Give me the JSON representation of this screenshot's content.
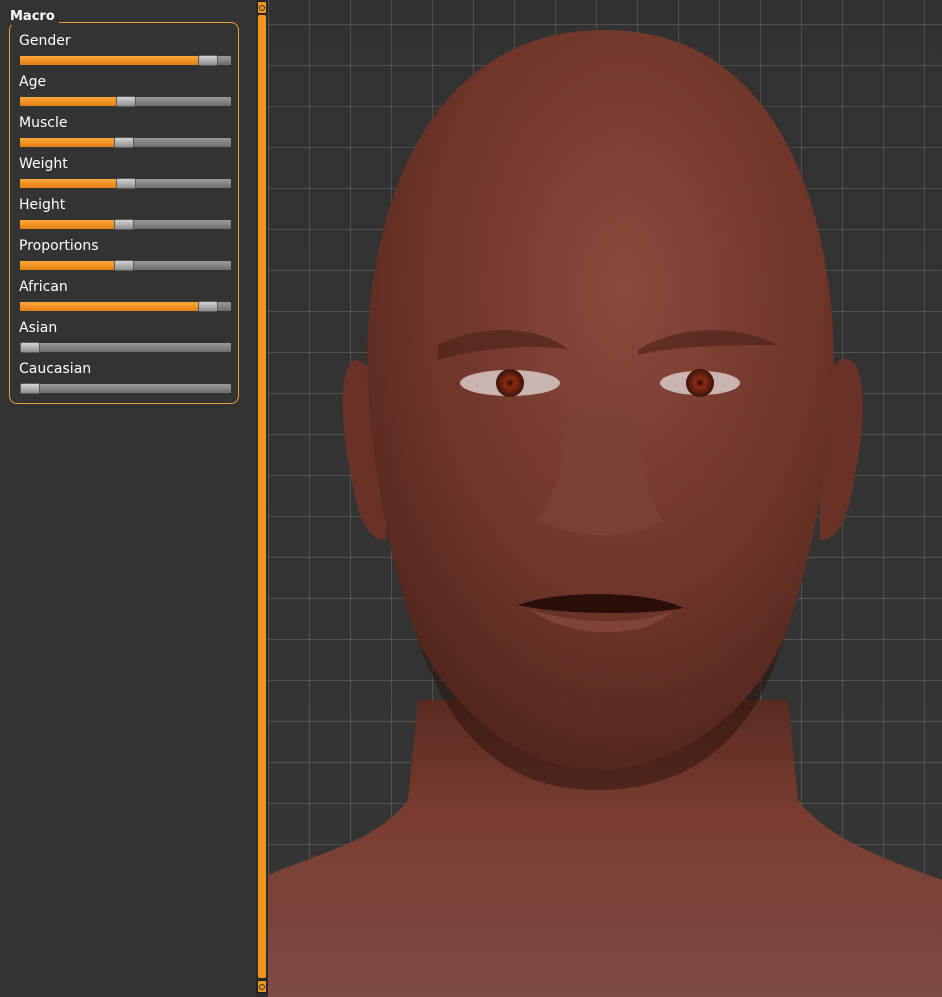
{
  "panel": {
    "group_title": "Macro",
    "sliders": [
      {
        "label": "Gender",
        "value": 0.93
      },
      {
        "label": "Age",
        "value": 0.5
      },
      {
        "label": "Muscle",
        "value": 0.49
      },
      {
        "label": "Weight",
        "value": 0.5
      },
      {
        "label": "Height",
        "value": 0.49
      },
      {
        "label": "Proportions",
        "value": 0.49
      },
      {
        "label": "African",
        "value": 0.93
      },
      {
        "label": "Asian",
        "value": 0.0
      },
      {
        "label": "Caucasian",
        "value": 0.0
      }
    ]
  },
  "colors": {
    "accent": "#f0951e",
    "panel_bg": "#333333",
    "viewport_bg": "#3a3a3a",
    "skin": "#7a3f30"
  },
  "viewport": {
    "content": "human-head-model"
  }
}
